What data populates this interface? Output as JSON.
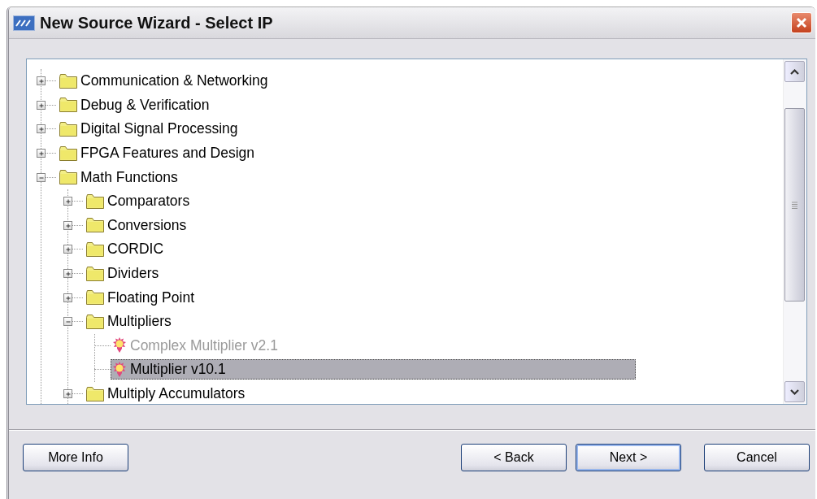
{
  "window": {
    "title": "New Source Wizard - Select IP"
  },
  "tree": [
    {
      "label": "Communication & Networking",
      "kind": "folder",
      "expanded": false,
      "selected": false,
      "disabled": false
    },
    {
      "label": "Debug & Verification",
      "kind": "folder",
      "expanded": false,
      "selected": false,
      "disabled": false
    },
    {
      "label": "Digital Signal Processing",
      "kind": "folder",
      "expanded": false,
      "selected": false,
      "disabled": false
    },
    {
      "label": "FPGA Features and Design",
      "kind": "folder",
      "expanded": false,
      "selected": false,
      "disabled": false
    },
    {
      "label": "Math Functions",
      "kind": "folder",
      "expanded": true,
      "selected": false,
      "disabled": false,
      "children": [
        {
          "label": "Comparators",
          "kind": "folder",
          "expanded": false,
          "selected": false,
          "disabled": false
        },
        {
          "label": "Conversions",
          "kind": "folder",
          "expanded": false,
          "selected": false,
          "disabled": false
        },
        {
          "label": "CORDIC",
          "kind": "folder",
          "expanded": false,
          "selected": false,
          "disabled": false
        },
        {
          "label": "Dividers",
          "kind": "folder",
          "expanded": false,
          "selected": false,
          "disabled": false
        },
        {
          "label": "Floating Point",
          "kind": "folder",
          "expanded": false,
          "selected": false,
          "disabled": false
        },
        {
          "label": "Multipliers",
          "kind": "folder",
          "expanded": true,
          "selected": false,
          "disabled": false,
          "children": [
            {
              "label": "Complex Multiplier v2.1",
              "kind": "core",
              "selected": false,
              "disabled": true
            },
            {
              "label": "Multiplier v10.1",
              "kind": "core",
              "selected": true,
              "disabled": false
            }
          ]
        },
        {
          "label": "Multiply Accumulators",
          "kind": "folder",
          "expanded": false,
          "selected": false,
          "disabled": false
        }
      ]
    }
  ],
  "buttons": [
    {
      "label": "More Info",
      "kind": "plain"
    },
    {
      "label": "< Back",
      "kind": "plain"
    },
    {
      "label": "Next >",
      "kind": "default"
    },
    {
      "label": "Cancel",
      "kind": "plain"
    }
  ]
}
